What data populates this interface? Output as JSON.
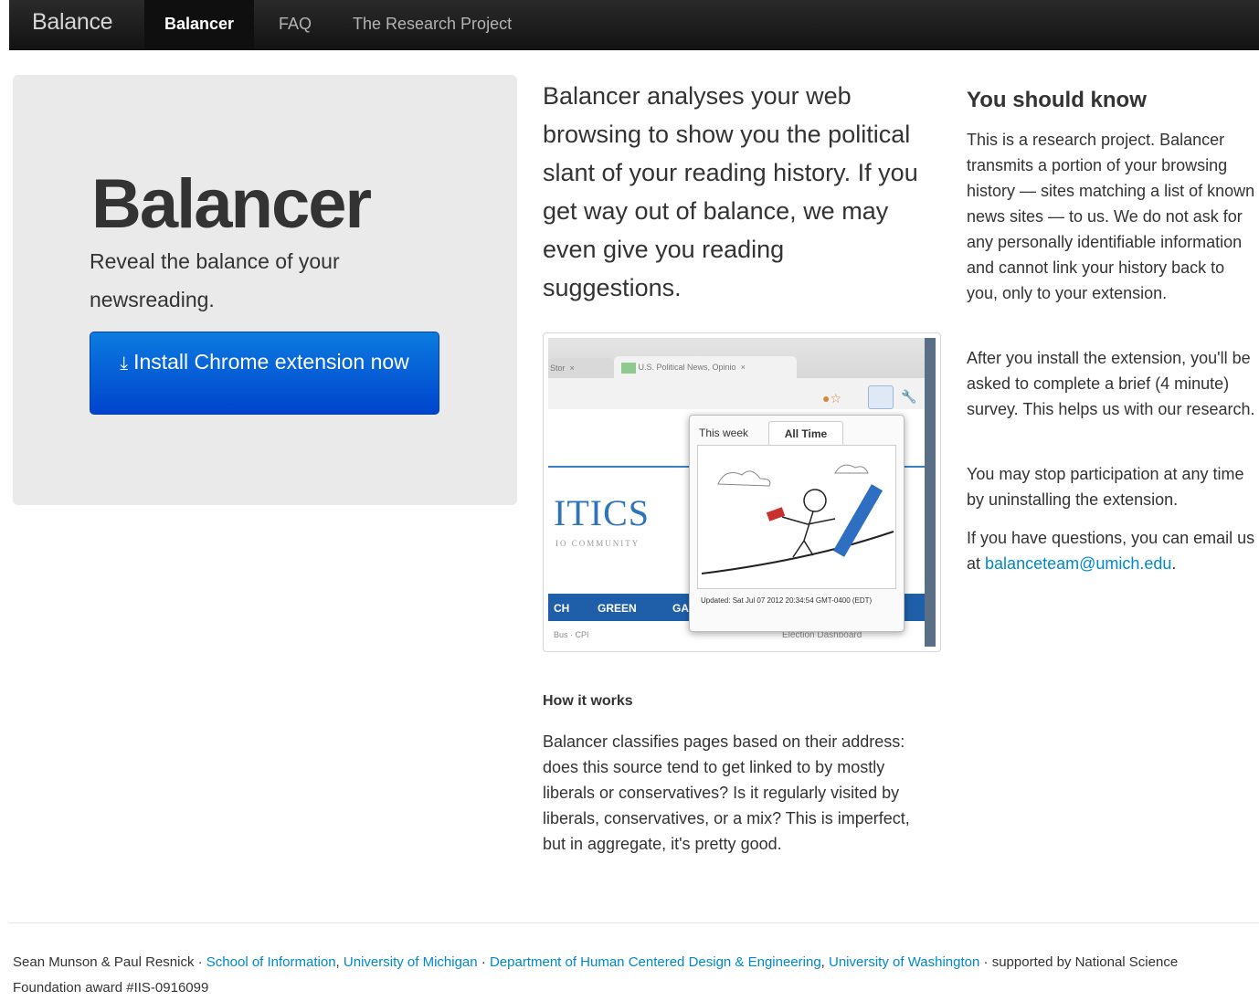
{
  "nav": {
    "brand": "Balance",
    "items": [
      {
        "label": "Balancer",
        "active": true
      },
      {
        "label": "FAQ",
        "active": false
      },
      {
        "label": "The Research Project",
        "active": false
      }
    ]
  },
  "hero": {
    "title": "Balancer",
    "subtitle": "Reveal the balance of your newsreading.",
    "install_button": "Install Chrome extension now",
    "install_icon": "download-icon"
  },
  "main": {
    "lead": "Balancer analyses your web browsing to show you the political slant of your reading history. If you get way out of balance, we may even give you reading suggestions.",
    "screenshot": {
      "tab1": "U.S. Political News, Opinio",
      "tab0": "Stor",
      "popup_tab_week": "This week",
      "popup_tab_all": "All Time",
      "updated": "Updated: Sat Jul 07 2012 20:34:54 GMT-0400 (EDT)",
      "site_logo": "ITICS",
      "site_tagline": "IO COMMUNITY",
      "menu_left": "CH",
      "menu_green": "GREEN",
      "menu_ga": "GA",
      "bottom_left": "Bus · CPI",
      "bottom_right": "Election Dashboard"
    },
    "how_title": "How it works",
    "how_text": "Balancer classifies pages based on their address: does this source tend to get linked to by mostly liberals or conservatives? Is it regularly visited by liberals, conservatives, or a mix? This is imperfect, but in aggregate, it's pretty good."
  },
  "sidebar": {
    "title": "You should know",
    "p1": "This is a research project. Balancer transmits a portion of your browsing history — sites matching a list of known news sites — to us. We do not ask for any personally identifiable information and cannot link your history back to you, only to your extension.",
    "p2": "After you install the extension, you'll be asked to complete a brief (4 minute) survey. This helps us with our research.",
    "p3": "You may stop participation at any time by uninstalling the extension.",
    "p4_prefix": "If you have questions, you can email us at",
    "email": "balanceteam@umich.edu",
    "p4_suffix": "."
  },
  "footer": {
    "authors": "Sean Munson & Paul Resnick",
    "sep": " · ",
    "link1": "School of Information",
    "comma": ", ",
    "link2": "University of Michigan",
    "link3": "Department of Human Centered Design & Engineering",
    "link4": "University of Washington",
    "supported": "supported by National Science Foundation award #IIS-0916099"
  },
  "colors": {
    "nav_bg": "#1b1b1b",
    "button_blue": "#0044cc",
    "link_blue": "#0088cc",
    "hero_bg": "#eaeaea"
  }
}
